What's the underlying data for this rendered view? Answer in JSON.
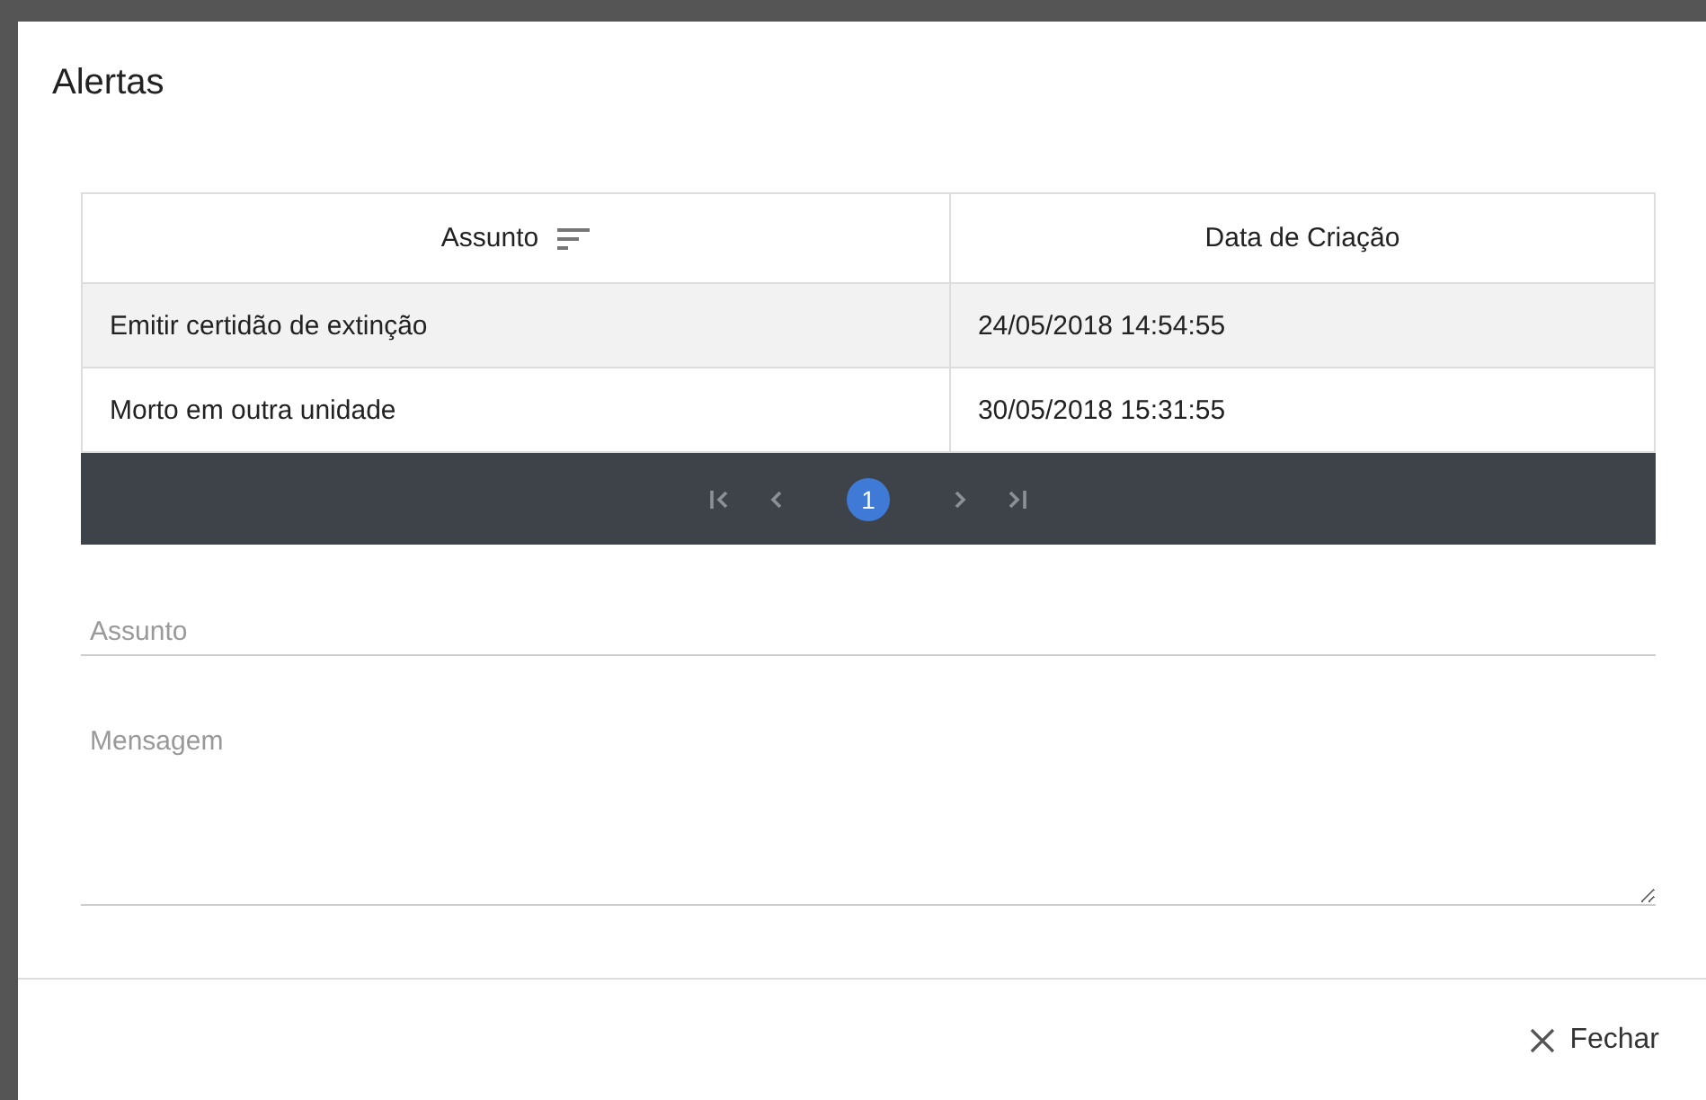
{
  "dialog": {
    "title": "Alertas"
  },
  "table": {
    "columns": [
      {
        "label": "Assunto",
        "sortable": true
      },
      {
        "label": "Data de Criação",
        "sortable": false
      }
    ],
    "rows": [
      {
        "cells": [
          "Emitir certidão de extinção",
          "24/05/2018 14:54:55"
        ],
        "highlighted": true
      },
      {
        "cells": [
          "Morto em outra unidade",
          "30/05/2018 15:31:55"
        ],
        "highlighted": false
      }
    ]
  },
  "pagination": {
    "pages": [
      {
        "label": "1",
        "selected": true
      }
    ]
  },
  "form": {
    "subject": {
      "placeholder": "Assunto"
    },
    "message": {
      "placeholder": "Mensagem"
    }
  },
  "footer": {
    "close_button": "Fechar"
  }
}
